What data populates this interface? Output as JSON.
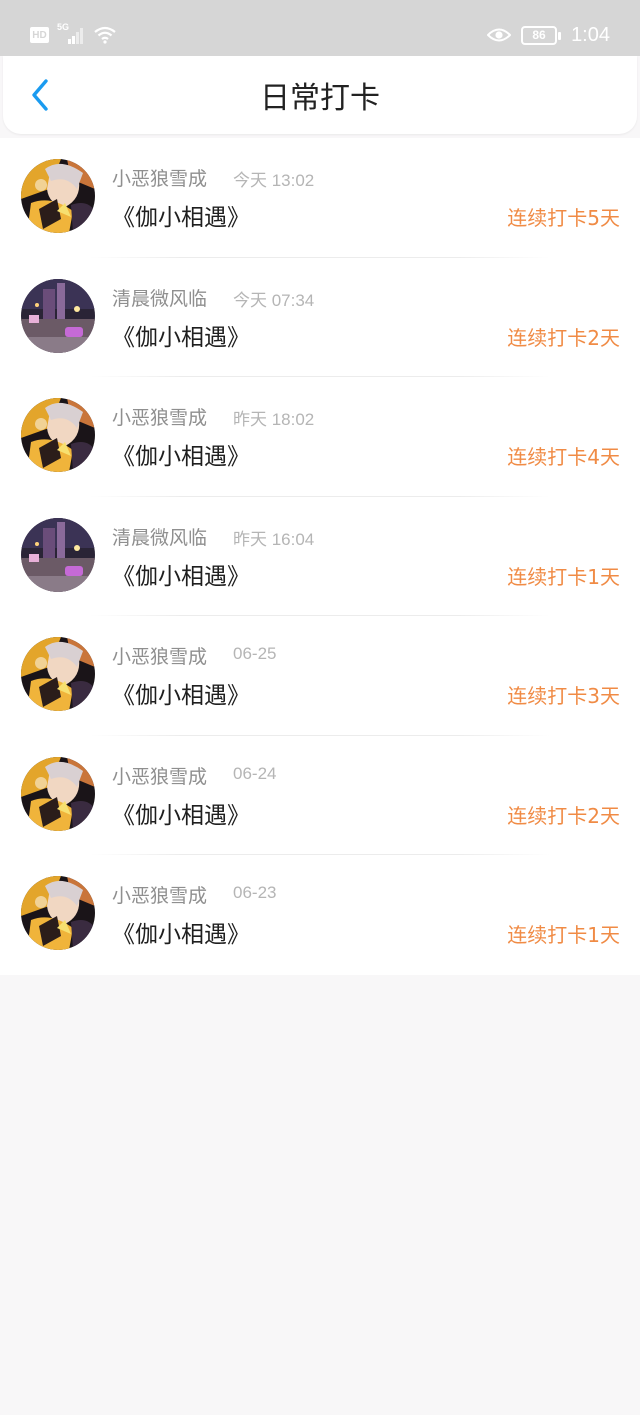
{
  "status_bar": {
    "hd_label": "HD",
    "network_label": "5G",
    "battery_level": "86",
    "time": "1:04"
  },
  "header": {
    "title": "日常打卡"
  },
  "colors": {
    "accent_orange": "#f08b45",
    "back_blue": "#1a9bf0"
  },
  "checkins": [
    {
      "user": "小恶狼雪成",
      "time": "今天 13:02",
      "title": "《伽小相遇》",
      "streak": "连续打卡5天",
      "avatar": "anime"
    },
    {
      "user": "清晨微风临",
      "time": "今天 07:34",
      "title": "《伽小相遇》",
      "streak": "连续打卡2天",
      "avatar": "night-street"
    },
    {
      "user": "小恶狼雪成",
      "time": "昨天 18:02",
      "title": "《伽小相遇》",
      "streak": "连续打卡4天",
      "avatar": "anime"
    },
    {
      "user": "清晨微风临",
      "time": "昨天 16:04",
      "title": "《伽小相遇》",
      "streak": "连续打卡1天",
      "avatar": "night-street"
    },
    {
      "user": "小恶狼雪成",
      "time": "06-25",
      "title": "《伽小相遇》",
      "streak": "连续打卡3天",
      "avatar": "anime"
    },
    {
      "user": "小恶狼雪成",
      "time": "06-24",
      "title": "《伽小相遇》",
      "streak": "连续打卡2天",
      "avatar": "anime"
    },
    {
      "user": "小恶狼雪成",
      "time": "06-23",
      "title": "《伽小相遇》",
      "streak": "连续打卡1天",
      "avatar": "anime"
    }
  ]
}
